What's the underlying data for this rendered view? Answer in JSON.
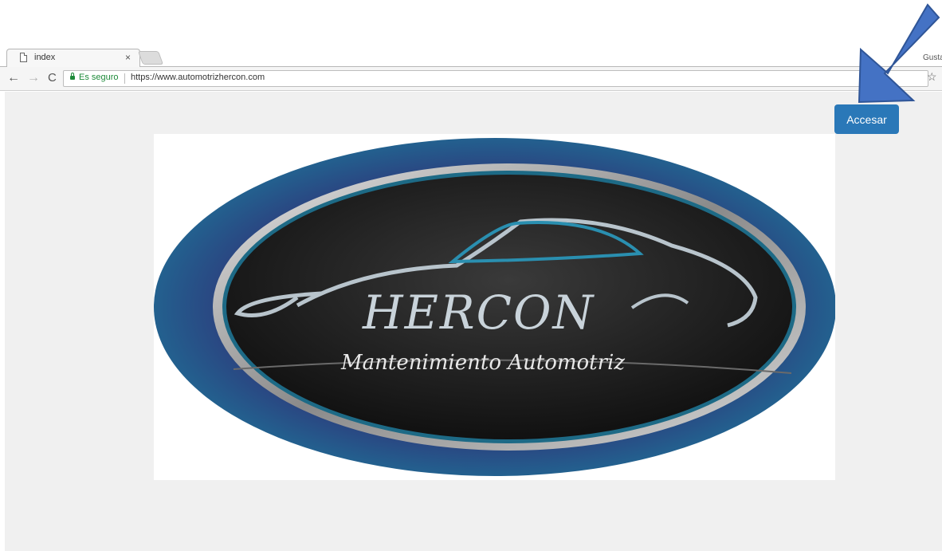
{
  "browser": {
    "tab": {
      "title": "index",
      "close": "×"
    },
    "user_name": "Gusta",
    "nav": {
      "back": "←",
      "forward": "→",
      "reload": "C"
    },
    "address": {
      "secure_label": "Es seguro",
      "url": "https://www.automotrizhercon.com"
    },
    "star": "☆"
  },
  "page": {
    "access_button": "Accesar",
    "logo": {
      "brand": "HERCON",
      "tagline": "Mantenimiento Automotriz"
    }
  },
  "colors": {
    "button": "#2a78b8",
    "arrow": "#4472c4",
    "secure": "#1e8a3a",
    "logo_outer": "#2f4f86",
    "logo_inner": "#1c1c1c"
  }
}
